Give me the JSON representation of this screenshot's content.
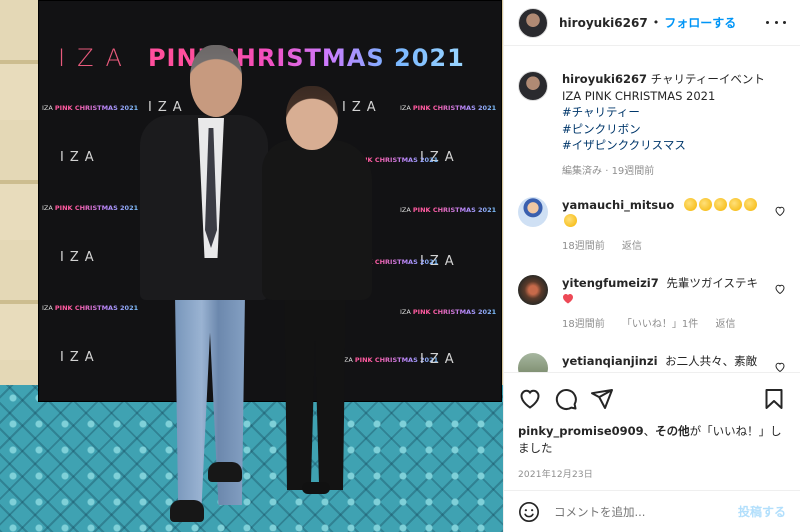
{
  "backdrop": {
    "title_iza": "IZA",
    "title_pink": "PINK ",
    "title_christmas": "CHRISTMAS 2021",
    "logo_iza": "IZA",
    "small_pink": "PINK ",
    "small_christmas": "CHRISTMAS 2021"
  },
  "header": {
    "username": "hiroyuki6267",
    "dot": "•",
    "follow_label": "フォローする"
  },
  "caption": {
    "username": "hiroyuki6267",
    "text": "チャリティーイベント IZA PINK CHRISTMAS 2021",
    "hashtags": [
      "#チャリティー",
      "#ピンクリボン",
      "#イザピンククリスマス"
    ],
    "edited": "編集済み",
    "sep": "·",
    "time": "19週間前"
  },
  "comments": [
    {
      "username": "yamauchi_mitsuo",
      "text": "",
      "emoji": "clap-emoji ×6",
      "time": "18週間前",
      "reply": "返信",
      "likes": ""
    },
    {
      "username": "yitengfumeizi7",
      "text": "先輩ツガイステキ",
      "emoji": "heart-emoji",
      "time": "18週間前",
      "reply": "返信",
      "likes": "「いいね！」1件"
    },
    {
      "username": "yetianqianjinzi",
      "text": "お二人共々、素敵で"
    }
  ],
  "actions": {
    "likes_user": "pinky_promise0909",
    "likes_mid": "、",
    "likes_others": "その他",
    "likes_tail": "が「いいね！」しました",
    "date": "2021年12月23日"
  },
  "add_comment": {
    "placeholder": "コメントを追加...",
    "post_label": "投稿する"
  },
  "colors": {
    "accent": "#0095f6",
    "hashtag": "#00376b",
    "muted": "#8e8e8e",
    "post_disabled": "#b2dffc",
    "heart": "#ed4956"
  }
}
